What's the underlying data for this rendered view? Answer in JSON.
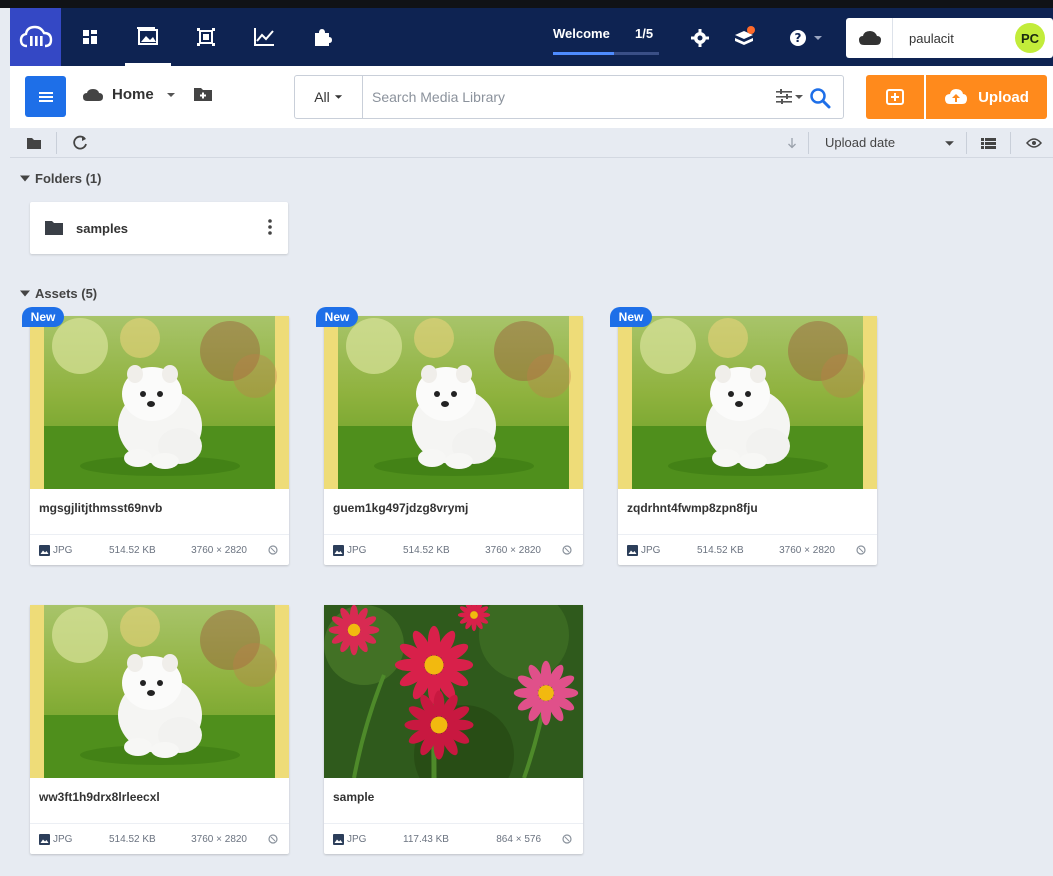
{
  "topbar": {
    "welcome_label": "Welcome",
    "progress_text": "1/5",
    "welcome_progress": 0.58,
    "nav_icons": [
      "dashboard-icon",
      "media-library-icon",
      "asset-crop-icon",
      "reports-icon",
      "addons-icon"
    ],
    "account": {
      "username": "paulacit",
      "avatar_initials": "PC"
    }
  },
  "subbar": {
    "home_label": "Home",
    "search_type": "All",
    "search_placeholder": "Search Media Library",
    "upload_label": "Upload"
  },
  "toolbar": {
    "sort_label": "Upload date"
  },
  "folders": {
    "title": "Folders (1)",
    "items": [
      {
        "name": "samples"
      }
    ]
  },
  "assets": {
    "title": "Assets (5)",
    "new_badge": "New",
    "items": [
      {
        "name": "mgsgjlitjthmsst69nvb",
        "format": "JPG",
        "size": "514.52 KB",
        "dimensions": "3760 × 2820",
        "is_new": true,
        "image": "puppy"
      },
      {
        "name": "guem1kg497jdzg8vrymj",
        "format": "JPG",
        "size": "514.52 KB",
        "dimensions": "3760 × 2820",
        "is_new": true,
        "image": "puppy"
      },
      {
        "name": "zqdrhnt4fwmp8zpn8fju",
        "format": "JPG",
        "size": "514.52 KB",
        "dimensions": "3760 × 2820",
        "is_new": true,
        "image": "puppy"
      },
      {
        "name": "ww3ft1h9drx8lrleecxl",
        "format": "JPG",
        "size": "514.52 KB",
        "dimensions": "3760 × 2820",
        "is_new": false,
        "image": "puppy"
      },
      {
        "name": "sample",
        "format": "JPG",
        "size": "117.43 KB",
        "dimensions": "864 × 576",
        "is_new": false,
        "image": "flowers"
      }
    ]
  },
  "colors": {
    "topbar_bg": "#0e2352",
    "logo_bg": "#3448c5",
    "primary_blue": "#1e6fe8",
    "upload_orange": "#ff8a1c",
    "avatar_green": "#c2ec3a",
    "page_bg": "#e7ebf2"
  }
}
